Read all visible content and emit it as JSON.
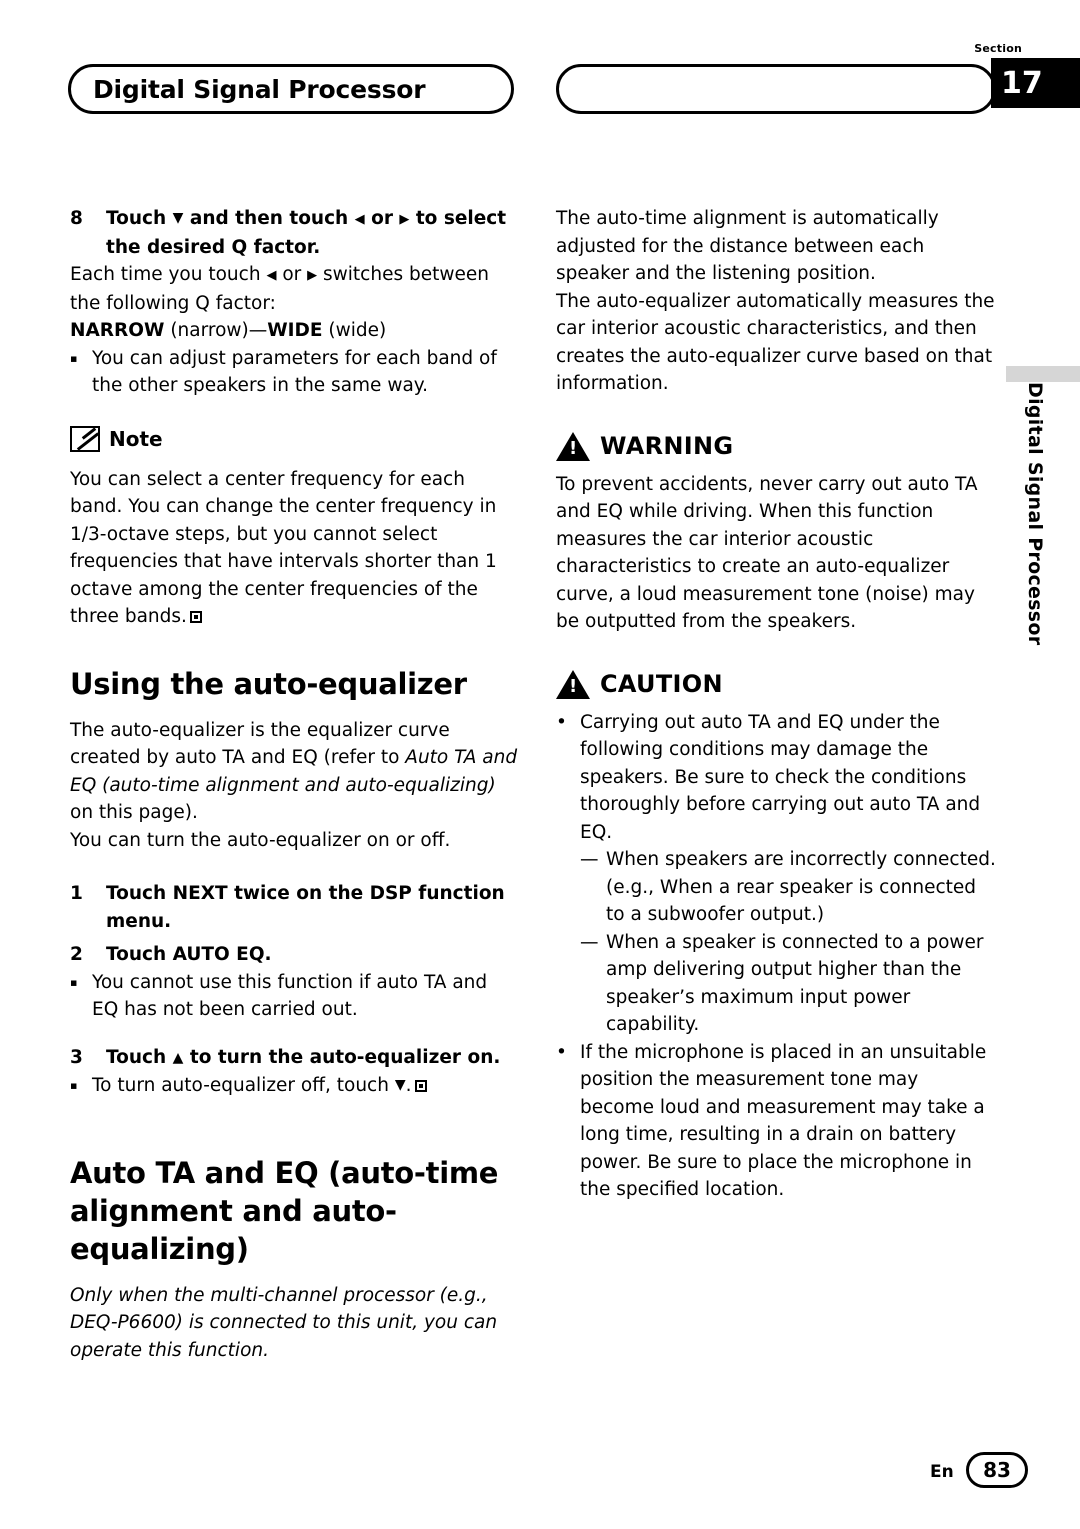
{
  "header": {
    "title": "Digital Signal Processor",
    "section_label": "Section",
    "section_number": "17"
  },
  "side_tab": {
    "text": "Digital Signal Processor"
  },
  "left_column": {
    "step8": {
      "number": "8",
      "text_before": "Touch ",
      "text_mid": " and then touch ",
      "text_mid2": " or ",
      "text_after": " to select the desired Q factor."
    },
    "step8_body_1": "Each time you touch ",
    "step8_body_2": " or ",
    "step8_body_3": " switches between the following Q factor:",
    "q_factor_line": {
      "narrow_bold": "NARROW",
      "narrow_plain": " (narrow)—",
      "wide_bold": "WIDE",
      "wide_plain": " (wide)"
    },
    "bullet_1": "You can adjust parameters for each band of the other speakers in the same way.",
    "note_label": "Note",
    "note_body": "You can select a center frequency for each band. You can change the center frequency in 1/3-octave steps, but you cannot select frequencies that have intervals shorter than 1 octave among the center frequencies of the three bands.",
    "heading_auto_eq": "Using the auto-equalizer",
    "auto_eq_para_1a": "The auto-equalizer is the equalizer curve created by auto TA and EQ (refer to ",
    "auto_eq_para_1b": "Auto TA and EQ (auto-time alignment and auto-equalizing)",
    "auto_eq_para_1c": " on this page).",
    "auto_eq_para_2": "You can turn the auto-equalizer on or off.",
    "step1": {
      "number": "1",
      "text": "Touch NEXT twice on the DSP function menu."
    },
    "step2": {
      "number": "2",
      "text": "Touch AUTO EQ."
    },
    "bullet_2": "You cannot use this function if auto TA and EQ has not been carried out.",
    "step3": {
      "number": "3",
      "text_a": "Touch ",
      "text_b": " to turn the auto-equalizer on."
    },
    "bullet_3_a": "To turn auto-equalizer off, touch ",
    "bullet_3_b": ".",
    "heading_auto_ta": "Auto TA and EQ (auto-time alignment and auto-equalizing)",
    "auto_ta_italic": "Only when the multi-channel processor (e.g., DEQ-P6600) is connected to this unit, you can operate this function."
  },
  "right_column": {
    "para_1": "The auto-time alignment is automatically adjusted for the distance between each speaker and the listening position.",
    "para_2": "The auto-equalizer automatically measures the car interior acoustic characteristics, and then creates the auto-equalizer curve based on that information.",
    "warning_label": "WARNING",
    "warning_body": "To prevent accidents, never carry out auto TA and EQ while driving. When this function measures the car interior acoustic characteristics to create an auto-equalizer curve, a loud measurement tone (noise) may be outputted from the speakers.",
    "caution_label": "CAUTION",
    "caution_bullet_1": "Carrying out auto TA and EQ under the following conditions may damage the speakers. Be sure to check the conditions thoroughly before carrying out auto TA and EQ.",
    "caution_dash_1": "When speakers are incorrectly connected. (e.g., When a rear speaker is connected to a subwoofer output.)",
    "caution_dash_2": "When a speaker is connected to a power amp delivering output higher than the speaker’s maximum input power capability.",
    "caution_bullet_2": "If the microphone is placed in an unsuitable position the measurement tone may become loud and measurement may take a long time, resulting in a drain on battery power. Be sure to place the microphone in the specified location."
  },
  "footer": {
    "lang": "En",
    "page_number": "83"
  },
  "glyphs": {
    "triangle_down": "▼",
    "triangle_up": "▲",
    "triangle_left": "◀",
    "triangle_right": "▶",
    "square_bullet": "▪",
    "round_bullet": "•",
    "em_dash": "—"
  }
}
